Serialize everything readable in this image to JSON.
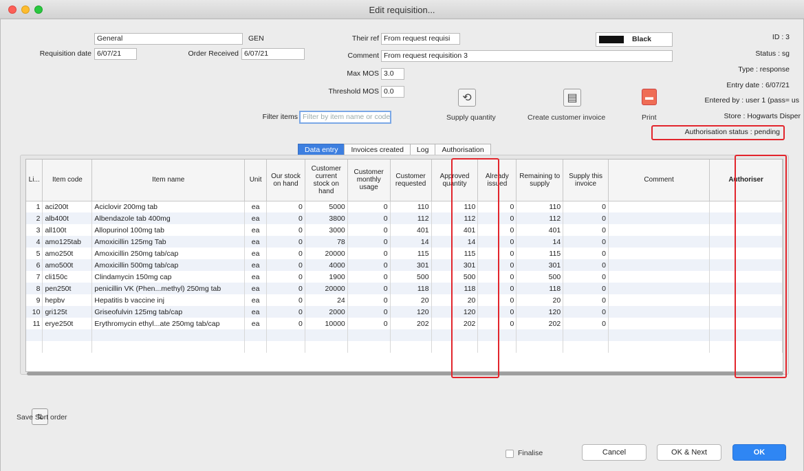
{
  "window": {
    "title": "Edit requisition..."
  },
  "form": {
    "name_value": "General",
    "code_value": "GEN",
    "requisition_date_label": "Requisition date",
    "requisition_date_value": "6/07/21",
    "order_received_label": "Order Received",
    "order_received_value": "6/07/21",
    "their_ref_label": "Their ref",
    "their_ref_value": "From request requisi",
    "comment_label": "Comment",
    "comment_value": "From request requisition 3",
    "max_mos_label": "Max MOS",
    "max_mos_value": "3.0",
    "threshold_mos_label": "Threshold MOS",
    "threshold_mos_value": "0.0",
    "filter_label": "Filter items",
    "filter_placeholder": "Filter by item name or code"
  },
  "color_selector": {
    "label": "Black",
    "color": "#111111"
  },
  "toolbar": {
    "supply_quantity": "Supply quantity",
    "create_customer_invoice": "Create customer invoice",
    "print": "Print"
  },
  "info": {
    "id": "ID : 3",
    "status": "Status : sg",
    "type": "Type : response",
    "entry_date": "Entry date : 6/07/21",
    "entered_by": "Entered by : user 1 (pass= us",
    "store": "Store : Hogwarts Disper",
    "authorisation_status": "Authorisation status : pending"
  },
  "tabs": [
    "Data entry",
    "Invoices created",
    "Log",
    "Authorisation"
  ],
  "table": {
    "columns": [
      "Li...",
      "Item code",
      "Item name",
      "Unit",
      "Our stock on hand",
      "Customer current stock on hand",
      "Customer monthly usage",
      "Customer requested",
      "Approved quantity",
      "Already issued",
      "Remaining to supply",
      "Supply this invoice",
      "Comment",
      "Authoriser"
    ],
    "rows": [
      [
        "1",
        "aci200t",
        "Aciclovir 200mg tab",
        "ea",
        "0",
        "5000",
        "0",
        "110",
        "110",
        "0",
        "110",
        "0",
        "",
        ""
      ],
      [
        "2",
        "alb400t",
        "Albendazole tab 400mg",
        "ea",
        "0",
        "3800",
        "0",
        "112",
        "112",
        "0",
        "112",
        "0",
        "",
        ""
      ],
      [
        "3",
        "all100t",
        "Allopurinol 100mg tab",
        "ea",
        "0",
        "3000",
        "0",
        "401",
        "401",
        "0",
        "401",
        "0",
        "",
        ""
      ],
      [
        "4",
        "amo125tab",
        "Amoxicillin 125mg Tab",
        "ea",
        "0",
        "78",
        "0",
        "14",
        "14",
        "0",
        "14",
        "0",
        "",
        ""
      ],
      [
        "5",
        "amo250t",
        "Amoxicillin 250mg tab/cap",
        "ea",
        "0",
        "20000",
        "0",
        "115",
        "115",
        "0",
        "115",
        "0",
        "",
        ""
      ],
      [
        "6",
        "amo500t",
        "Amoxicillin 500mg tab/cap",
        "ea",
        "0",
        "4000",
        "0",
        "301",
        "301",
        "0",
        "301",
        "0",
        "",
        ""
      ],
      [
        "7",
        "cli150c",
        "Clindamycin 150mg cap",
        "ea",
        "0",
        "1900",
        "0",
        "500",
        "500",
        "0",
        "500",
        "0",
        "",
        ""
      ],
      [
        "8",
        "pen250t",
        "penicillin VK (Phen...methyl) 250mg tab",
        "ea",
        "0",
        "20000",
        "0",
        "118",
        "118",
        "0",
        "118",
        "0",
        "",
        ""
      ],
      [
        "9",
        "hepbv",
        "Hepatitis b vaccine inj",
        "ea",
        "0",
        "24",
        "0",
        "20",
        "20",
        "0",
        "20",
        "0",
        "",
        ""
      ],
      [
        "10",
        "gri125t",
        "Griseofulvin 125mg tab/cap",
        "ea",
        "0",
        "2000",
        "0",
        "120",
        "120",
        "0",
        "120",
        "0",
        "",
        ""
      ],
      [
        "11",
        "erye250t",
        "Erythromycin ethyl...ate 250mg tab/cap",
        "ea",
        "0",
        "10000",
        "0",
        "202",
        "202",
        "0",
        "202",
        "0",
        "",
        ""
      ]
    ]
  },
  "footer": {
    "save_sort_order": "Save Sort order",
    "finalise": "Finalise",
    "cancel": "Cancel",
    "ok_next": "OK & Next",
    "ok": "OK"
  }
}
